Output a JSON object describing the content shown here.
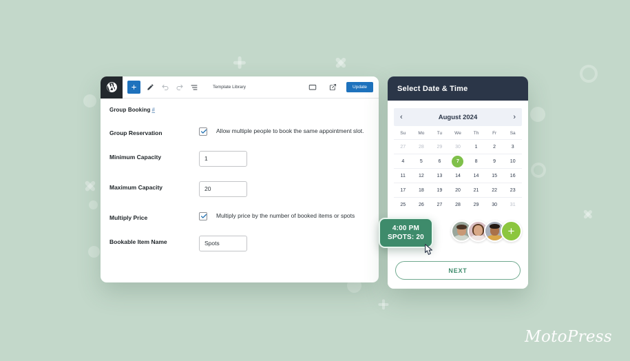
{
  "background": {
    "color": "#c3d8ca",
    "accent_green": "#8cc63f",
    "brand_green": "#3e8b6b"
  },
  "brand": {
    "name": "MotoPress"
  },
  "wp_editor": {
    "toolbar": {
      "logo_icon": "wordpress-icon",
      "add_block_icon": "plus-icon",
      "edit_icon": "pencil-icon",
      "undo_icon": "undo-icon",
      "redo_icon": "redo-icon",
      "list_view_icon": "list-view-icon",
      "template_library_label": "Template Library",
      "preview_icon": "desktop-preview-icon",
      "external_link_icon": "external-link-icon",
      "update_label": "Update"
    },
    "section": {
      "title": "Group Booking",
      "anchor": "#"
    },
    "fields": [
      {
        "label": "Group Reservation",
        "type": "checkbox",
        "checked": true,
        "text": "Allow multiple people to book the same appointment slot."
      },
      {
        "label": "Minimum Capacity",
        "type": "text",
        "value": "1"
      },
      {
        "label": "Maximum Capacity",
        "type": "text",
        "value": "20"
      },
      {
        "label": "Multiply Price",
        "type": "checkbox",
        "checked": true,
        "text": "Multiply price by the number of booked items or spots"
      },
      {
        "label": "Bookable Item Name",
        "type": "text",
        "value": "Spots"
      }
    ]
  },
  "booking_widget": {
    "header_title": "Select Date & Time",
    "calendar": {
      "prev_icon": "chevron-left-icon",
      "next_icon": "chevron-right-icon",
      "month_label": "August 2024",
      "weekdays": [
        "Su",
        "Mo",
        "Tu",
        "We",
        "Th",
        "Fr",
        "Sa"
      ],
      "selected_day": "7",
      "weeks": [
        [
          {
            "d": "27",
            "muted": true
          },
          {
            "d": "28",
            "muted": true
          },
          {
            "d": "29",
            "muted": true
          },
          {
            "d": "30",
            "muted": true
          },
          {
            "d": "1"
          },
          {
            "d": "2"
          },
          {
            "d": "3"
          }
        ],
        [
          {
            "d": "4"
          },
          {
            "d": "5"
          },
          {
            "d": "6"
          },
          {
            "d": "7",
            "selected": true
          },
          {
            "d": "8"
          },
          {
            "d": "9"
          },
          {
            "d": "10"
          }
        ],
        [
          {
            "d": "11"
          },
          {
            "d": "12"
          },
          {
            "d": "13"
          },
          {
            "d": "14"
          },
          {
            "d": "14"
          },
          {
            "d": "15"
          },
          {
            "d": "16"
          }
        ],
        [
          {
            "d": "17"
          },
          {
            "d": "18"
          },
          {
            "d": "19"
          },
          {
            "d": "20"
          },
          {
            "d": "21"
          },
          {
            "d": "22"
          },
          {
            "d": "23"
          }
        ],
        [
          {
            "d": "25"
          },
          {
            "d": "26"
          },
          {
            "d": "27"
          },
          {
            "d": "28"
          },
          {
            "d": "29"
          },
          {
            "d": "30"
          },
          {
            "d": "31",
            "muted": true
          }
        ]
      ]
    },
    "time_slot": {
      "time": "4:00 PM",
      "spots": "SPOTS: 20"
    },
    "attendees": {
      "add_icon": "plus-icon",
      "avatars": [
        "attendee-avatar-1",
        "attendee-avatar-2",
        "attendee-avatar-3"
      ]
    },
    "next_label": "NEXT",
    "cursor_icon": "pointer-cursor-icon"
  }
}
